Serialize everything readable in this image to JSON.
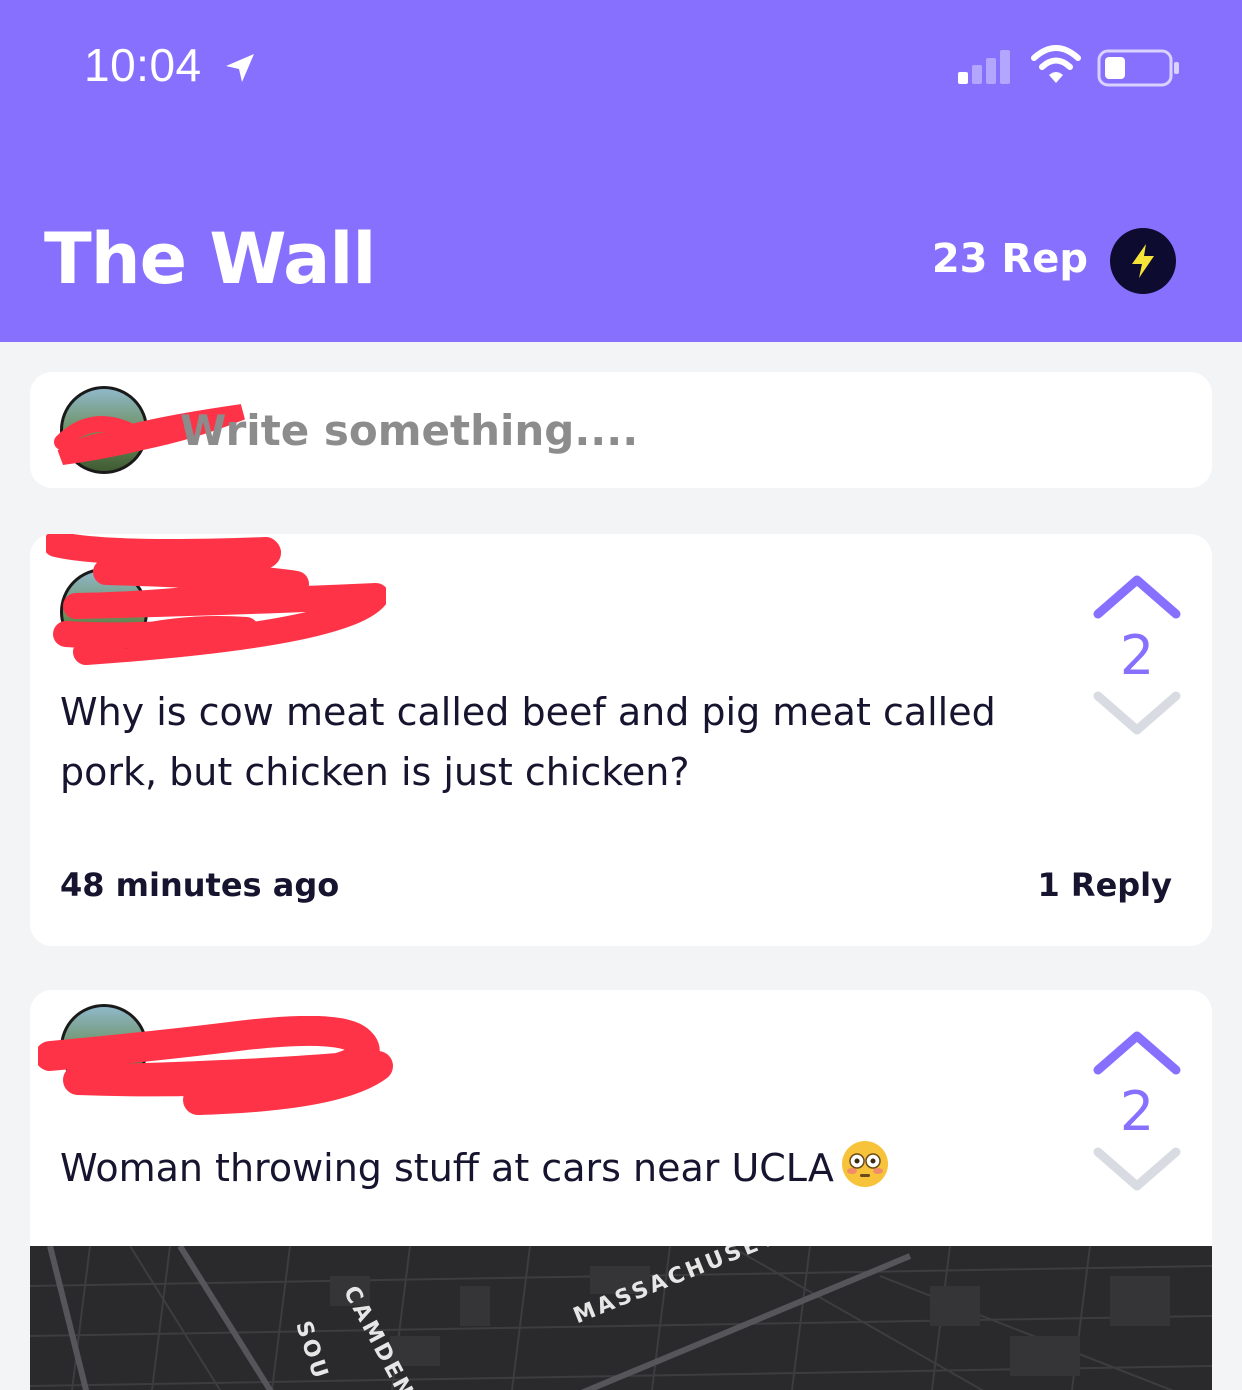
{
  "status_bar": {
    "time": "10:04",
    "icons": [
      "location-arrow-icon",
      "cellular-signal-icon",
      "wifi-icon",
      "battery-icon"
    ]
  },
  "header": {
    "title": "The Wall",
    "rep_label": "23 Rep",
    "badge_icon": "lightning-bolt-icon",
    "background_color": "#8870ff",
    "badge_color": "#0d0b30",
    "bolt_color": "#f5e33a"
  },
  "composer": {
    "placeholder": "Write something...."
  },
  "posts": [
    {
      "text": "Why is cow meat called beef and pig meat called pork, but chicken is just chicken?",
      "votes": "2",
      "timestamp": "48 minutes ago",
      "replies": "1 Reply"
    },
    {
      "text": "Woman throwing stuff at cars near UCLA",
      "emoji": "flushed-face-emoji",
      "votes": "2",
      "map_labels": [
        "MASSACHUSETTS AVE.",
        "CAMDEN",
        "SOU"
      ]
    }
  ],
  "colors": {
    "accent": "#8870ff",
    "vote_inactive": "#d8dbe2",
    "text_dark": "#16142e",
    "redaction": "#ff3347"
  }
}
